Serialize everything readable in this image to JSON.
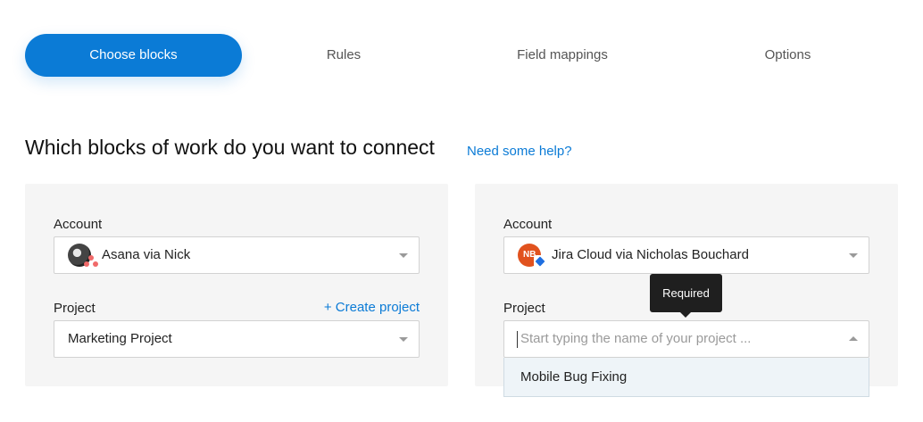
{
  "tabs": [
    {
      "label": "Choose blocks",
      "active": true
    },
    {
      "label": "Rules",
      "active": false
    },
    {
      "label": "Field mappings",
      "active": false
    },
    {
      "label": "Options",
      "active": false
    }
  ],
  "heading": "Which blocks of work do you want to connect",
  "help_link": "Need some help?",
  "left_panel": {
    "account_label": "Account",
    "account_value": "Asana via Nick",
    "account_icon": "asana-avatar-icon",
    "project_label": "Project",
    "create_project": "+ Create project",
    "project_value": "Marketing Project"
  },
  "right_panel": {
    "account_label": "Account",
    "account_value": "Jira Cloud via Nicholas Bouchard",
    "avatar_initials": "NB",
    "account_icon": "jira-avatar-icon",
    "project_label": "Project",
    "project_placeholder": "Start typing the name of your project ...",
    "dropdown_options": [
      "Mobile Bug Fixing"
    ],
    "tooltip": "Required"
  },
  "colors": {
    "accent": "#0b7bd6",
    "panel_bg": "#f5f5f5",
    "tooltip_bg": "#1f1f1f",
    "jira_avatar": "#e1521e",
    "asana_dots": "#f06a6a"
  }
}
